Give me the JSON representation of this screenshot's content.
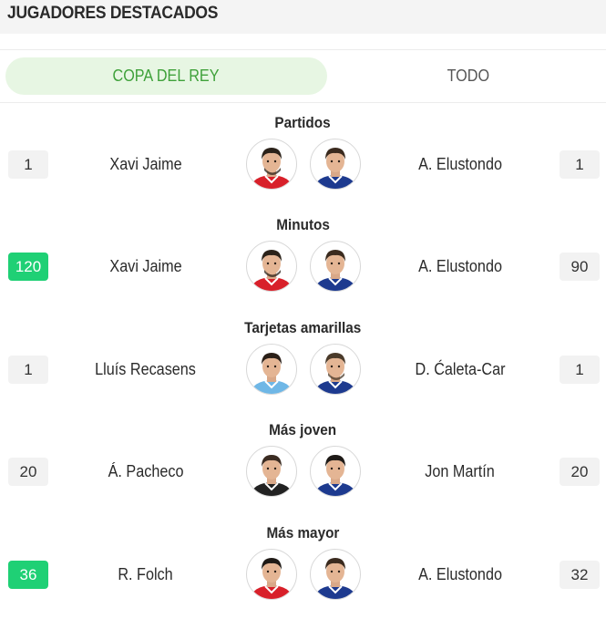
{
  "header": {
    "title": "JUGADORES DESTACADOS"
  },
  "tabs": [
    {
      "label": "COPA DEL REY",
      "active": true
    },
    {
      "label": "TODO",
      "active": false
    }
  ],
  "colors": {
    "accent_green": "#3fa13a",
    "lead_badge": "#1fd075",
    "tab_active_bg": "#e7f6e3"
  },
  "stats": [
    {
      "title": "Partidos",
      "left": {
        "value": "1",
        "player": "Xavi Jaime",
        "lead": false,
        "kit": "red",
        "hair": "#2b2219",
        "beard": true
      },
      "right": {
        "value": "1",
        "player": "A. Elustondo",
        "lead": false,
        "kit": "blue",
        "hair": "#3a2a1e",
        "beard": false
      }
    },
    {
      "title": "Minutos",
      "left": {
        "value": "120",
        "player": "Xavi Jaime",
        "lead": true,
        "kit": "red",
        "hair": "#2b2219",
        "beard": true
      },
      "right": {
        "value": "90",
        "player": "A. Elustondo",
        "lead": false,
        "kit": "blue",
        "hair": "#3a2a1e",
        "beard": false
      }
    },
    {
      "title": "Tarjetas amarillas",
      "left": {
        "value": "1",
        "player": "Lluís Recasens",
        "lead": false,
        "kit": "lightblue",
        "hair": "#2a1f18",
        "beard": false
      },
      "right": {
        "value": "1",
        "player": "D. Ćaleta-Car",
        "lead": false,
        "kit": "blue",
        "hair": "#4a3a2a",
        "beard": true
      }
    },
    {
      "title": "Más joven",
      "left": {
        "value": "20",
        "player": "Á. Pacheco",
        "lead": false,
        "kit": "black",
        "hair": "#3b2c22",
        "beard": false
      },
      "right": {
        "value": "20",
        "player": "Jon Martín",
        "lead": false,
        "kit": "blue",
        "hair": "#1e1a17",
        "beard": false
      }
    },
    {
      "title": "Más mayor",
      "left": {
        "value": "36",
        "player": "R. Folch",
        "lead": true,
        "kit": "red",
        "hair": "#1f1a16",
        "beard": false
      },
      "right": {
        "value": "32",
        "player": "A. Elustondo",
        "lead": false,
        "kit": "blue",
        "hair": "#3a2a1e",
        "beard": false
      }
    }
  ]
}
